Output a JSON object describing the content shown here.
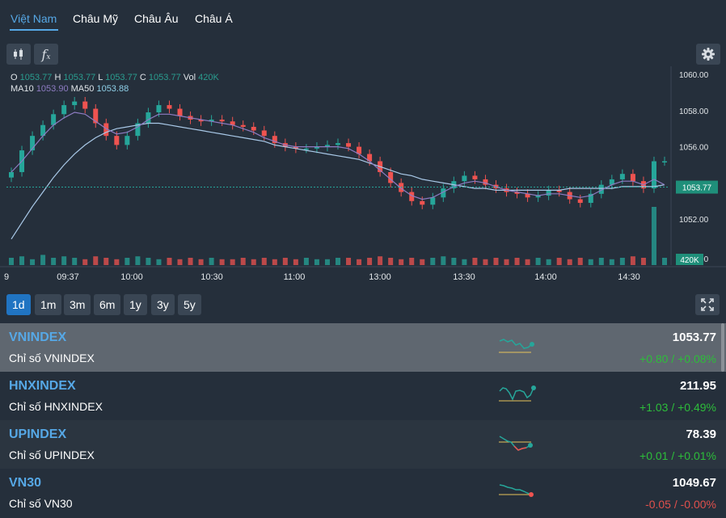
{
  "tabs": [
    "Việt Nam",
    "Châu Mỹ",
    "Châu Âu",
    "Châu Á"
  ],
  "toolbar": {
    "candle_icon": "candlestick-icon",
    "fx_label": "f",
    "settings_icon": "gear-icon"
  },
  "legend": {
    "o_label": "O",
    "o": "1053.77",
    "h_label": "H",
    "h": "1053.77",
    "l_label": "L",
    "l": "1053.77",
    "c_label": "C",
    "c": "1053.77",
    "vol_label": "Vol",
    "vol": "420K",
    "ma10_label": "MA10",
    "ma10": "1053.90",
    "ma50_label": "MA50",
    "ma50": "1053.88"
  },
  "chart_data": {
    "type": "line",
    "y_ticks": [
      "1060.00",
      "1058.00",
      "1056.00",
      "1052.00",
      "1050.00"
    ],
    "x_ticks": [
      "9",
      "09:37",
      "10:00",
      "10:30",
      "11:00",
      "13:00",
      "13:30",
      "14:00",
      "14:30"
    ],
    "last_price_label": "1053.77",
    "last_volume_label": "420K",
    "ylim": [
      1050,
      1060
    ],
    "price": [
      1054.6,
      1055.8,
      1056.6,
      1057.2,
      1057.8,
      1058.3,
      1058.5,
      1058.1,
      1057.3,
      1056.6,
      1056.1,
      1056.6,
      1057.3,
      1057.9,
      1058.3,
      1058.1,
      1057.7,
      1057.5,
      1057.4,
      1057.5,
      1057.4,
      1057.2,
      1057.1,
      1056.9,
      1056.6,
      1056.2,
      1056.0,
      1055.9,
      1055.9,
      1056.0,
      1056.1,
      1056.2,
      1056.0,
      1055.6,
      1055.2,
      1054.6,
      1054.0,
      1053.5,
      1053.0,
      1052.8,
      1053.2,
      1053.7,
      1054.1,
      1054.4,
      1054.2,
      1053.9,
      1053.7,
      1053.5,
      1053.4,
      1053.2,
      1053.3,
      1053.6,
      1053.5,
      1053.1,
      1052.9,
      1053.4,
      1053.9,
      1054.2,
      1054.5,
      1054.1,
      1053.7,
      1055.2,
      1055.2
    ],
    "ma10": [
      1054.6,
      1055.2,
      1055.9,
      1056.6,
      1057.2,
      1057.6,
      1057.9,
      1057.8,
      1057.4,
      1057.0,
      1056.7,
      1056.8,
      1057.1,
      1057.5,
      1057.8,
      1057.8,
      1057.7,
      1057.6,
      1057.5,
      1057.4,
      1057.3,
      1057.2,
      1057.0,
      1056.8,
      1056.5,
      1056.3,
      1056.1,
      1056.0,
      1056.0,
      1056.0,
      1056.0,
      1056.0,
      1055.9,
      1055.6,
      1055.2,
      1054.7,
      1054.2,
      1053.7,
      1053.3,
      1053.1,
      1053.2,
      1053.5,
      1053.8,
      1054.0,
      1054.1,
      1054.0,
      1053.8,
      1053.6,
      1053.5,
      1053.4,
      1053.3,
      1053.4,
      1053.4,
      1053.3,
      1053.2,
      1053.3,
      1053.6,
      1053.9,
      1054.1,
      1054.1,
      1053.9,
      1054.2,
      1053.9
    ],
    "ma50": [
      1050.9,
      1051.8,
      1052.7,
      1053.5,
      1054.3,
      1055.0,
      1055.6,
      1056.1,
      1056.5,
      1056.8,
      1057.0,
      1057.1,
      1057.2,
      1057.3,
      1057.3,
      1057.2,
      1057.1,
      1057.0,
      1056.9,
      1056.8,
      1056.7,
      1056.6,
      1056.5,
      1056.4,
      1056.3,
      1056.1,
      1056.0,
      1055.9,
      1055.8,
      1055.7,
      1055.6,
      1055.5,
      1055.4,
      1055.3,
      1055.1,
      1054.9,
      1054.7,
      1054.5,
      1054.4,
      1054.2,
      1054.1,
      1054.0,
      1053.9,
      1053.8,
      1053.7,
      1053.7,
      1053.6,
      1053.6,
      1053.6,
      1053.6,
      1053.6,
      1053.6,
      1053.6,
      1053.7,
      1053.7,
      1053.7,
      1053.7,
      1053.7,
      1053.8,
      1053.8,
      1053.8,
      1053.8,
      1053.9
    ],
    "volume_ratio": [
      0.5,
      0.6,
      0.4,
      0.7,
      0.5,
      0.6,
      0.5,
      0.4,
      0.6,
      0.5,
      0.4,
      0.5,
      0.6,
      0.5,
      0.4,
      0.5,
      0.4,
      0.5,
      0.4,
      0.5,
      0.4,
      0.4,
      0.5,
      0.4,
      0.5,
      0.4,
      0.5,
      0.4,
      0.5,
      0.4,
      0.4,
      0.5,
      0.5,
      0.4,
      0.5,
      0.6,
      0.5,
      0.4,
      0.5,
      0.4,
      0.5,
      0.6,
      0.5,
      0.4,
      0.5,
      0.4,
      0.5,
      0.4,
      0.5,
      0.4,
      0.5,
      0.4,
      0.5,
      0.4,
      0.5,
      0.4,
      0.5,
      0.4,
      0.5,
      0.6,
      0.5,
      4.0,
      0.5
    ]
  },
  "ranges": [
    "1d",
    "1m",
    "3m",
    "6m",
    "1y",
    "3y",
    "5y"
  ],
  "expand_icon": "expand-icon",
  "indices": [
    {
      "symbol": "VNINDEX",
      "name": "Chỉ số VNINDEX",
      "value": "1053.77",
      "change": "+0.80 / +0.08%",
      "dir": "up"
    },
    {
      "symbol": "HNXINDEX",
      "name": "Chỉ số HNXINDEX",
      "value": "211.95",
      "change": "+1.03 / +0.49%",
      "dir": "up"
    },
    {
      "symbol": "UPINDEX",
      "name": "Chỉ số UPINDEX",
      "value": "78.39",
      "change": "+0.01 / +0.01%",
      "dir": "up"
    },
    {
      "symbol": "VN30",
      "name": "Chỉ số VN30",
      "value": "1049.67",
      "change": "-0.05 / -0.00%",
      "dir": "down"
    }
  ],
  "colors": {
    "accent": "#56a8e6",
    "up": "#26a69a",
    "down": "#ef5350",
    "positive_text": "#2dbd3a",
    "negative_text": "#e0504c",
    "ma10": "#8e7cc3",
    "ma50": "#a9c9e8"
  }
}
